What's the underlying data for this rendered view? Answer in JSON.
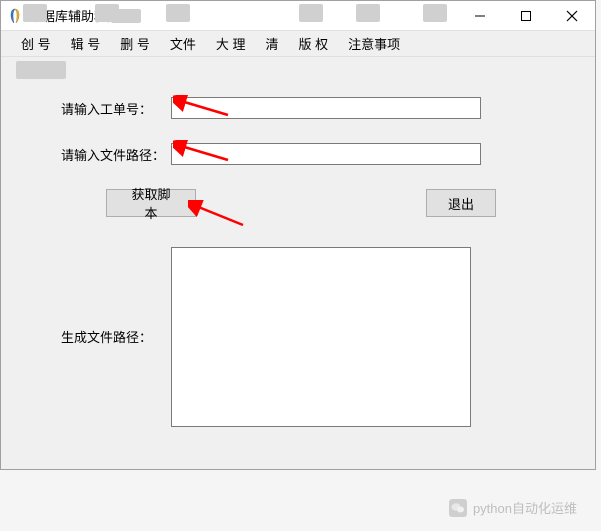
{
  "window": {
    "title": "数据库辅助程序"
  },
  "menu": {
    "items": [
      "创    号",
      "辑    号",
      "删    号",
      "文件",
      "大    理",
      "    清",
      "版    权",
      "注意事项"
    ]
  },
  "form": {
    "order_label": "请输入工单号：",
    "order_value": "",
    "path_label": "请输入文件路径：",
    "path_value": ""
  },
  "buttons": {
    "get_script": "获取脚本",
    "exit": "退出"
  },
  "output": {
    "label": "生成文件路径：",
    "value": ""
  },
  "watermark": {
    "text": "python自动化运维"
  },
  "annotations": {
    "arrow_color": "#ff0000"
  }
}
